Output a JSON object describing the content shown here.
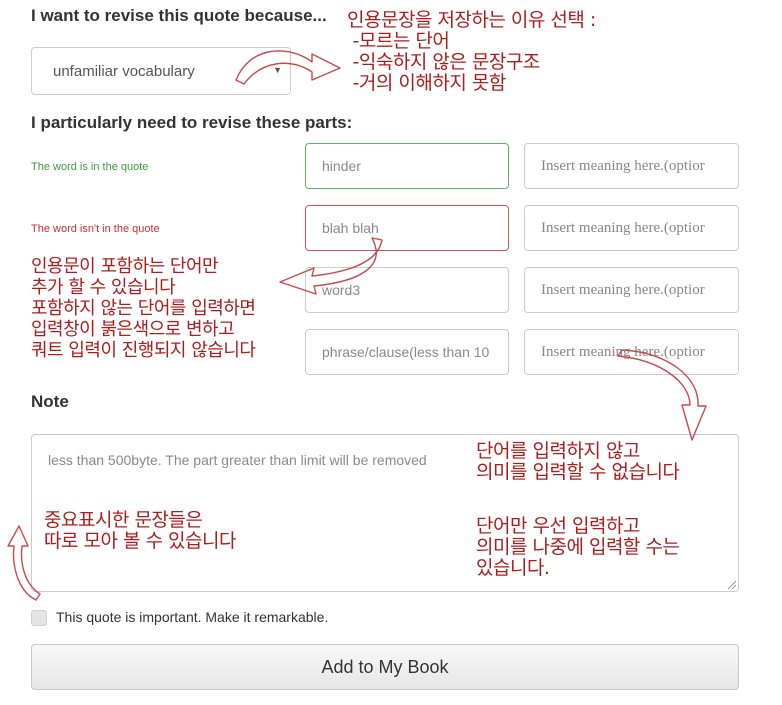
{
  "reason": {
    "heading": "I want to revise this quote because...",
    "selected": "unfamiliar vocabulary"
  },
  "parts": {
    "heading": "I particularly need to revise these parts:",
    "rows": [
      {
        "label": "The word is in the quote",
        "word_value": "hinder",
        "meaning_placeholder": "Insert meaning here.(optior"
      },
      {
        "label": "The word isn't in the quote",
        "word_value": "blah blah",
        "meaning_placeholder": "Insert meaning here.(optior"
      },
      {
        "label": "",
        "word_value": "word3",
        "meaning_placeholder": "Insert meaning here.(optior"
      },
      {
        "label": "",
        "word_value": "phrase/clause(less than 10",
        "meaning_placeholder": "Insert meaning here.(optior"
      }
    ]
  },
  "note": {
    "heading": "Note",
    "placeholder": "less than 500byte. The part greater than limit will be removed"
  },
  "important_checkbox": {
    "label": "This quote is important. Make it remarkable.",
    "checked": false
  },
  "add_button": {
    "label": "Add to My Book"
  },
  "annotations": {
    "reason_note": "인용문장을 저장하는 이유 선택 :\n -모르는 단어\n -익숙하지 않은 문장구조\n -거의 이해하지 못함",
    "word_note": "인용문이 포함하는 단어만\n추가 할 수 있습니다\n포함하지 않는 단어를 입력하면\n입력창이 붉은색으로 변하고\n쿼트 입력이 진행되지 않습니다",
    "meaning_note_1": "단어를 입력하지 않고\n의미를 입력할 수 없습니다",
    "meaning_note_2": "단어만 우선 입력하고\n의미를 나중에 입력할 수는\n있습니다.",
    "important_note": "중요표시한 문장들은\n따로 모아 볼 수 있습니다"
  },
  "colors": {
    "valid_border": "#5cb85c",
    "invalid_border": "#d9534f",
    "valid_label": "#3c9a3c",
    "invalid_label": "#c9302c",
    "annotation": "#b01c1c"
  }
}
